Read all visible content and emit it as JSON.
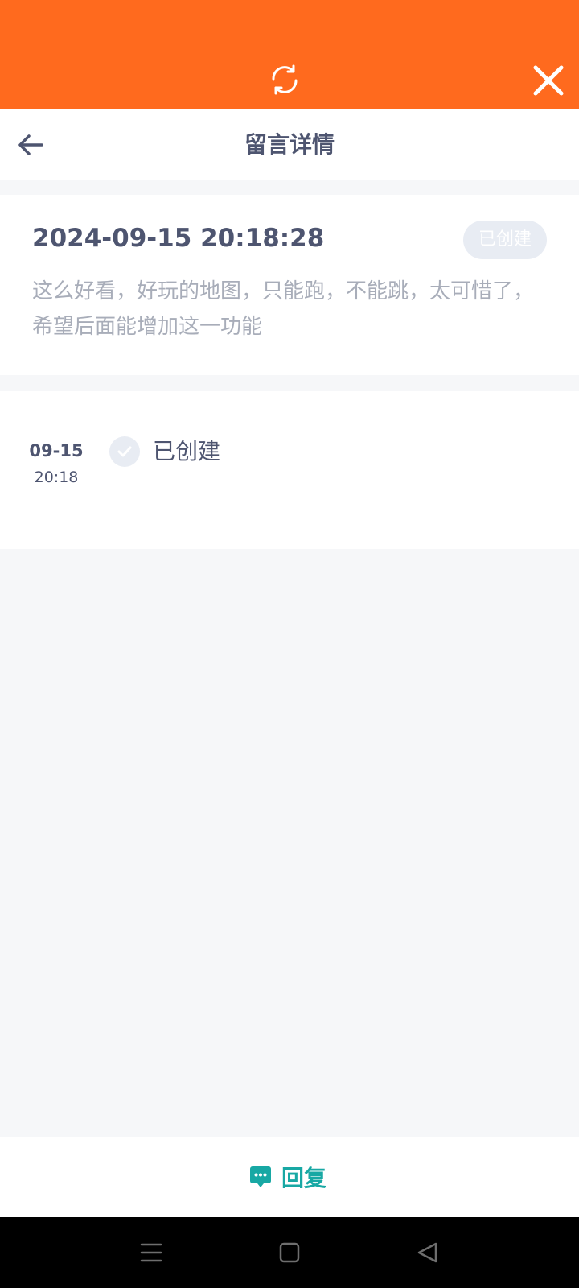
{
  "header": {
    "title": "留言详情"
  },
  "message": {
    "time": "2024-09-15 20:18:28",
    "status": "已创建",
    "content": "这么好看，好玩的地图，只能跑，不能跳，太可惜了，希望后面能增加这一功能"
  },
  "timeline": {
    "entries": [
      {
        "date": "09-15",
        "time": "20:18",
        "label": "已创建"
      }
    ]
  },
  "footer": {
    "reply_label": "回复"
  },
  "icons": {
    "refresh": "refresh-icon",
    "close": "close-icon",
    "back": "back-arrow-icon",
    "check": "check-icon",
    "reply": "chat-bubble-icon",
    "nav_menu": "menu-icon",
    "nav_home": "home-icon",
    "nav_back": "back-triangle-icon"
  },
  "colors": {
    "top_bar": "#ff6a1e",
    "title_text": "#4e5570",
    "muted_text": "#a8adb9",
    "badge_bg": "#e8ecf3",
    "reply_accent": "#18a8a4",
    "page_bg": "#f6f7f9"
  }
}
